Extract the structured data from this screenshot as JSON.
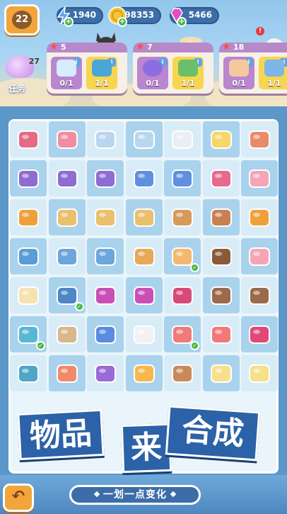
{
  "player": {
    "level": "22"
  },
  "resources": [
    {
      "name": "energy",
      "icon": "lightning-icon",
      "value": "1940",
      "color": "#5aa6f0"
    },
    {
      "name": "coins",
      "icon": "coin-icon",
      "value": "98353",
      "color": "#f7c531"
    },
    {
      "name": "gems",
      "icon": "gem-icon",
      "value": "5466",
      "color": "#e04fc4"
    }
  ],
  "quest": {
    "count": "27",
    "label": "任务"
  },
  "orders": [
    {
      "stars": "5",
      "slots": [
        {
          "item": "ice-crystal",
          "count": "0/1"
        },
        {
          "item": "blue-bag",
          "count": "1/1"
        }
      ]
    },
    {
      "stars": "7",
      "slots": [
        {
          "item": "purple-headphones",
          "count": "0/1"
        },
        {
          "item": "notebook",
          "count": "1/1"
        }
      ]
    },
    {
      "stars": "18",
      "slots": [
        {
          "item": "cake",
          "count": "0/1"
        },
        {
          "item": "gift",
          "count": "1/1"
        }
      ]
    }
  ],
  "board": {
    "items": [
      [
        "shopping-cart",
        "backpack",
        "fridge",
        "fridge",
        "ice-box",
        "yellow-cat",
        "bag"
      ],
      [
        "tent",
        "tent",
        "tent",
        "crystal",
        "crystal",
        "purse",
        "basket"
      ],
      [
        "bread-tray",
        "tea-set",
        "tea-set",
        "teapot",
        "coffee-cup",
        "tea-tray",
        "bread-tray"
      ],
      [
        "oven",
        "toaster",
        "toaster",
        "muffin",
        "cupcake",
        "hot-cocoa",
        "basket"
      ],
      [
        "dress",
        "boot",
        "bracelet",
        "bracelet",
        "necklace",
        "crystal-rock",
        "crystal-rock"
      ],
      [
        "ball-gown",
        "boots",
        "butter-dish",
        "mug",
        "lollipop",
        "lollipop",
        "ruby"
      ],
      [
        "spyglass",
        "juice",
        "gift-box",
        "orange-juice",
        "latte",
        "juice-glass",
        "juice-glass"
      ]
    ]
  },
  "banners": [
    "物品",
    "来",
    "合成"
  ],
  "footer": {
    "undo_icon": "back-arrow-icon",
    "tagline": "一划一点变化"
  }
}
